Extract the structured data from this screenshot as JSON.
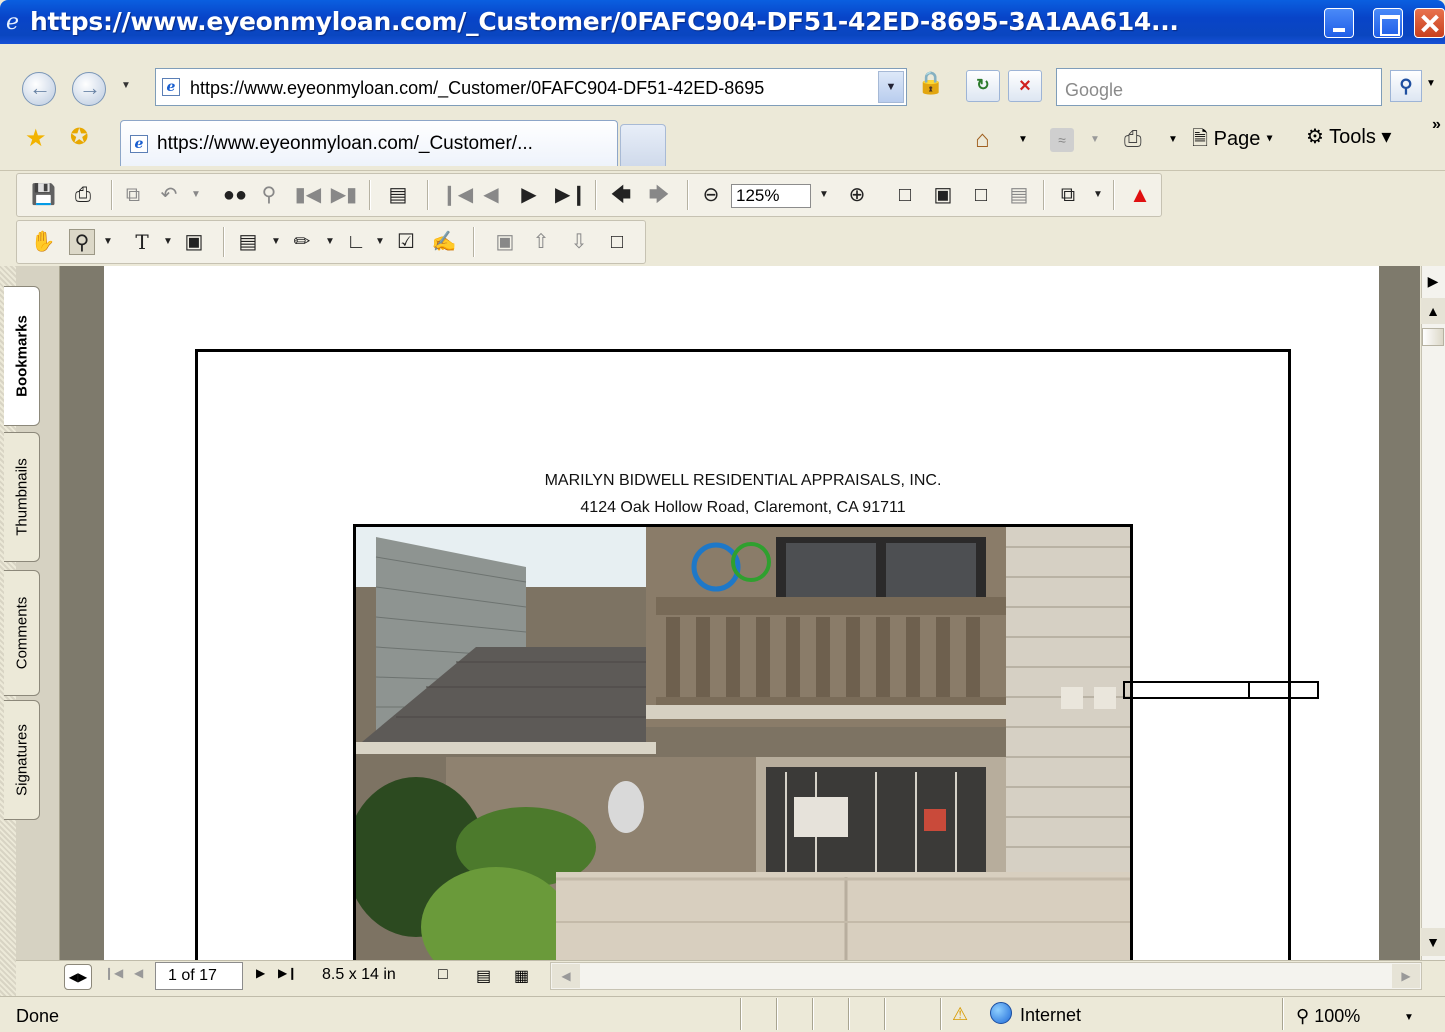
{
  "window": {
    "title": "https://www.eyeonmyloan.com/_Customer/0FAFC904-DF51-42ED-8695-3A1AA614..."
  },
  "address_bar": {
    "url": "https://www.eyeonmyloan.com/_Customer/0FAFC904-DF51-42ED-8695"
  },
  "search": {
    "placeholder": "Google"
  },
  "tabs": [
    {
      "label": "https://www.eyeonmyloan.com/_Customer/..."
    }
  ],
  "command_bar": {
    "page_label": "Page",
    "tools_label": "Tools"
  },
  "acrobat": {
    "zoom": "125%",
    "nav_tabs": [
      "Bookmarks",
      "Thumbnails",
      "Comments",
      "Signatures"
    ],
    "page_indicator": "1 of 17",
    "page_size": "8.5 x 14 in"
  },
  "document": {
    "company": "MARILYN BIDWELL RESIDENTIAL APPRAISALS, INC.",
    "address": "4124 Oak Hollow Road, Claremont, CA 91711"
  },
  "status": {
    "text": "Done",
    "zone": "Internet",
    "zoom": "100%"
  },
  "colors": {
    "titlebar": "#0844c8",
    "chrome": "#ece9d8",
    "doc_bg": "#7e7a6c"
  },
  "icons": [
    "ie-icon",
    "back-arrow-icon",
    "forward-arrow-icon",
    "lock-icon",
    "refresh-icon",
    "stop-icon",
    "search-icon",
    "favorites-star-icon",
    "add-favorite-icon",
    "home-icon",
    "feed-icon",
    "print-icon",
    "page-icon",
    "tools-gear-icon",
    "save-icon",
    "print-icon",
    "copy-icon",
    "undo-icon",
    "find-icon",
    "hand-icon",
    "zoom-in-icon",
    "adobe-icon",
    "globe-icon"
  ]
}
